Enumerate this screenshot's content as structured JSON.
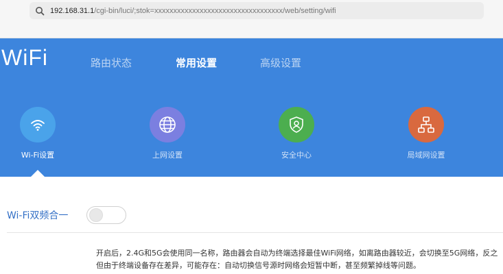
{
  "browser": {
    "url_host": "192.168.31.1",
    "url_path": "/cgi-bin/luci/;stok=xxxxxxxxxxxxxxxxxxxxxxxxxxxxxxxxxx/web/setting/wifi"
  },
  "header": {
    "logo": "WiFi",
    "nav": [
      {
        "label": "路由状态",
        "active": false
      },
      {
        "label": "常用设置",
        "active": true
      },
      {
        "label": "高级设置",
        "active": false
      }
    ]
  },
  "tiles": [
    {
      "label": "Wi-Fi设置",
      "icon": "wifi-icon",
      "color": "#4aa3ea",
      "active": true
    },
    {
      "label": "上网设置",
      "icon": "globe-icon",
      "color": "#7b7fe0",
      "active": false
    },
    {
      "label": "安全中心",
      "icon": "shield-icon",
      "color": "#4cae4f",
      "active": false
    },
    {
      "label": "局域网设置",
      "icon": "network-icon",
      "color": "#d9693f",
      "active": false
    }
  ],
  "setting": {
    "label": "Wi-Fi双频合一",
    "toggle_on": false,
    "description": [
      "开启后，2.4G和5G会使用同一名称，路由器会自动为终端选择最佳WiFi网络，如离路由器较近，会切换至5G网络，反之",
      "但由于终端设备存在差异，可能存在：自动切换信号源时网络会短暂中断，甚至频繁掉线等问题。"
    ]
  }
}
